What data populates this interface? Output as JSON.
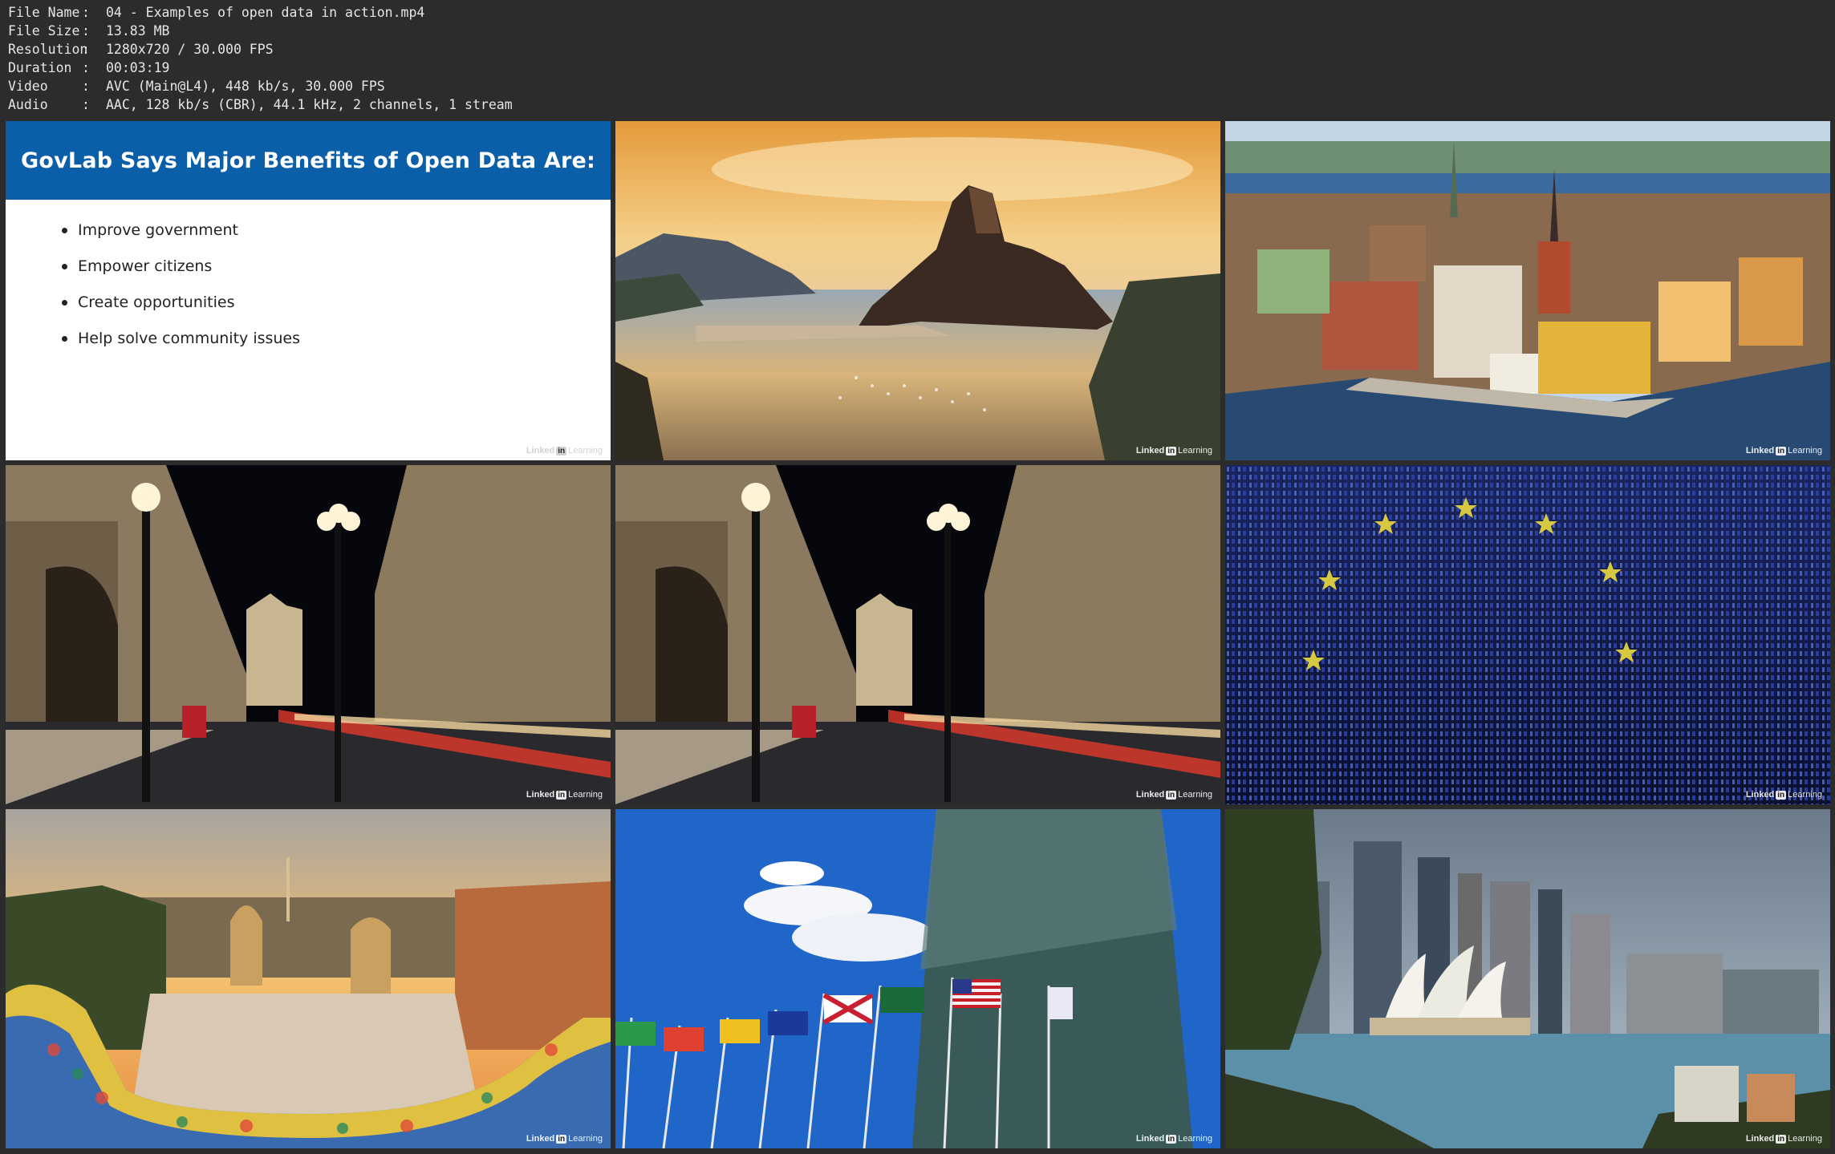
{
  "file_info": [
    {
      "key": "File Name",
      "value": "04 - Examples of open data in action.mp4"
    },
    {
      "key": "File Size",
      "value": "13.83 MB"
    },
    {
      "key": "Resolution",
      "value": "1280x720 / 30.000 FPS"
    },
    {
      "key": "Duration",
      "value": "00:03:19"
    },
    {
      "key": "Video",
      "value": "AVC (Main@L4), 448 kb/s, 30.000 FPS"
    },
    {
      "key": "Audio",
      "value": "AAC, 128 kb/s (CBR), 44.1 kHz, 2 channels, 1 stream"
    }
  ],
  "separator": ":",
  "slide": {
    "title": "GovLab Says Major Benefits of Open Data Are:",
    "bullets": [
      "Improve government",
      "Empower citizens",
      "Create opportunities",
      "Help solve community issues"
    ]
  },
  "watermark": {
    "part1": "Linked",
    "in": "in",
    "part2": "Learning"
  },
  "colors": {
    "slide_header": "#0b5ea8",
    "background": "#2c2c2c"
  }
}
